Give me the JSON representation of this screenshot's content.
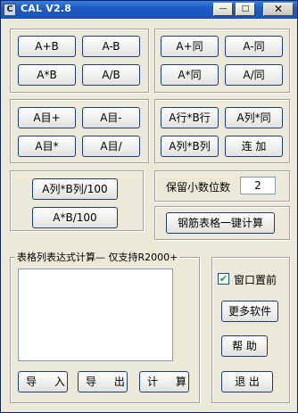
{
  "window": {
    "title": "CAL V2.8",
    "icon_glyph": "C",
    "minimize_glyph": "—",
    "maximize_glyph": "□",
    "close_glyph": "✕"
  },
  "ops_basic": {
    "a_plus_b": "A+B",
    "a_minus_b": "A-B",
    "a_times_b": "A*B",
    "a_div_b": "A/B"
  },
  "ops_same": {
    "a_plus_same": "A+同",
    "a_minus_same": "A-同",
    "a_times_same": "A*同",
    "a_div_same": "A/同"
  },
  "ops_self": {
    "a_self_plus": "A目+",
    "a_self_minus": "A目-",
    "a_self_times": "A目*",
    "a_self_div": "A目/"
  },
  "ops_rowcol": {
    "row_times_row": "A行*B行",
    "col_times_same": "A列*同",
    "col_times_col": "A列*B列",
    "concat": "连 加"
  },
  "ops_percent": {
    "col_times_col_div100": "A列*B列/100",
    "a_times_b_div100": "A*B/100"
  },
  "decimal": {
    "label": "保留小数位数",
    "value": "2"
  },
  "rebar_button": "钢筋表格一键计算",
  "expression": {
    "group_label": "表格列表达式计算— 仅支持R2000+",
    "value": ""
  },
  "bottom": {
    "import": "导 入",
    "export": "导 出",
    "calculate": "计 算"
  },
  "side": {
    "topmost_label": "窗口置前",
    "topmost_checked": "✔",
    "more_software": "更多软件",
    "help": "帮  助",
    "exit": "退  出"
  }
}
